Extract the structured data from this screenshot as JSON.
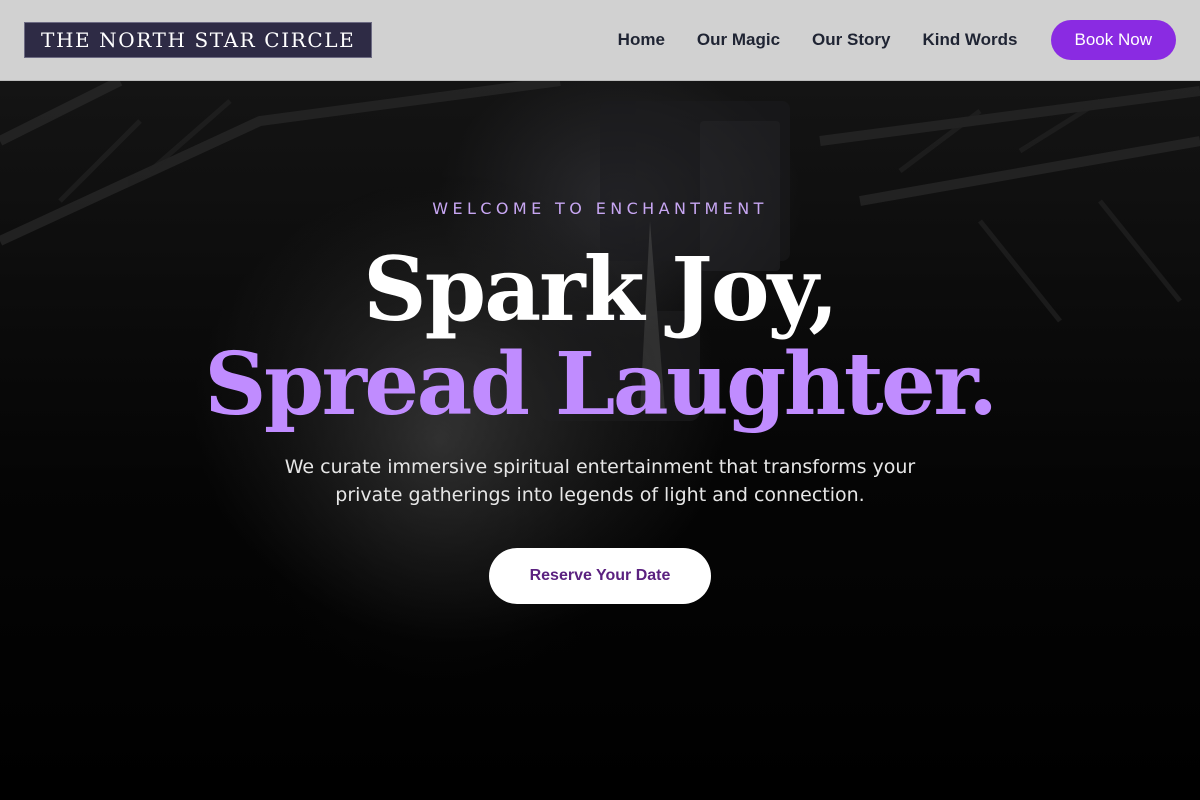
{
  "header": {
    "logo": "THE NORTH STAR CIRCLE",
    "nav": [
      "Home",
      "Our Magic",
      "Our Story",
      "Kind Words"
    ],
    "cta": "Book Now"
  },
  "hero": {
    "eyebrow": "WELCOME TO ENCHANTMENT",
    "headline_line1": "Spark Joy,",
    "headline_line2": "Spread Laughter.",
    "subtitle": "We curate immersive spiritual entertainment that transforms your private gatherings into legends of light and connection.",
    "cta": "Reserve Your Date"
  },
  "colors": {
    "header_bg": "#d1d1d1",
    "logo_bg": "#2e2b45",
    "accent_purple": "#8a2be2",
    "headline_purple": "#c08cff",
    "eyebrow_purple": "#c7a6f2",
    "cta_text": "#5b2180",
    "hero_bg": "#000000"
  }
}
